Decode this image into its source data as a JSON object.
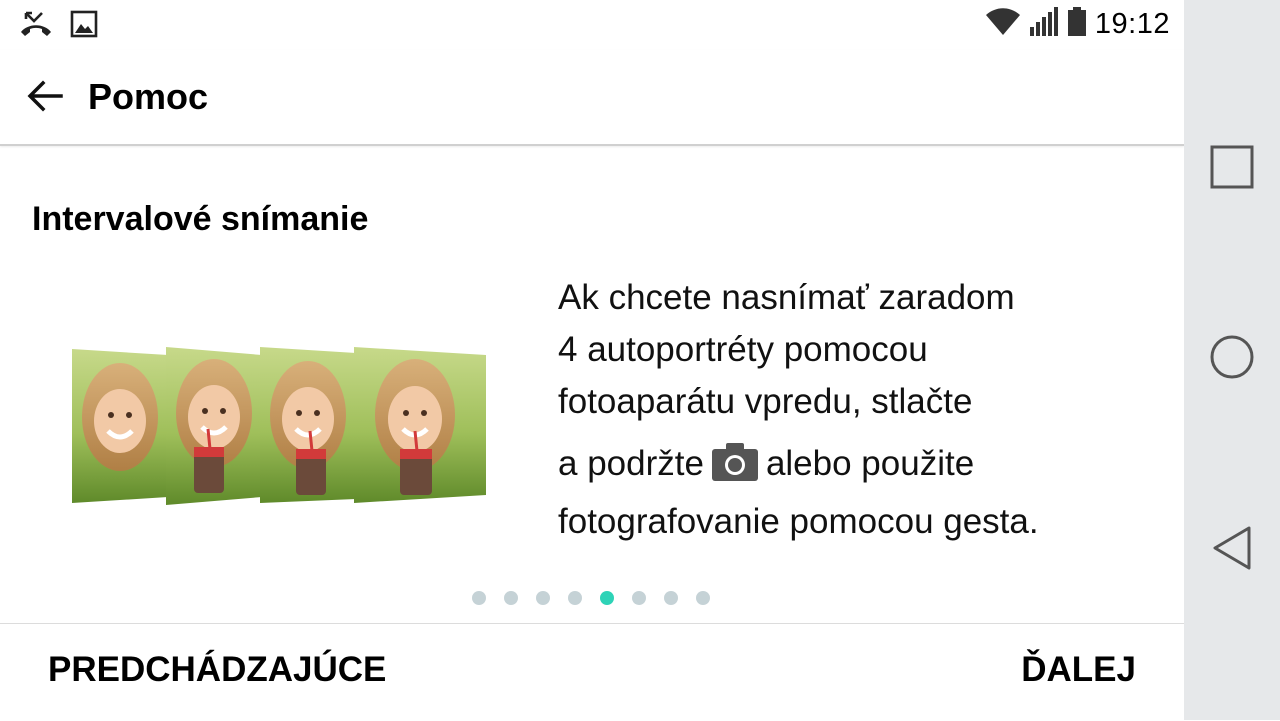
{
  "status_bar": {
    "time": "19:12",
    "left_icons": [
      "missed-call-icon",
      "image-icon"
    ],
    "right_icons": [
      "wifi-icon",
      "signal-icon",
      "battery-icon"
    ]
  },
  "app_bar": {
    "back_icon": "arrow-left-icon",
    "title": "Pomoc"
  },
  "content": {
    "section_title": "Intervalové snímanie",
    "description_lines": [
      "Ak chcete nasnímať zaradom",
      "4 autoportréty pomocou",
      "fotoaparátu vpredu, stlačte",
      "a podržte",
      "alebo použite",
      "fotografovanie pomocou gesta."
    ],
    "inline_icon": "camera-icon",
    "page_indicator": {
      "total": 8,
      "current": 5
    }
  },
  "footer": {
    "prev_label": "PREDCHÁDZAJÚCE",
    "next_label": "ĎALEJ"
  },
  "nav_bar": {
    "icons": [
      "recent-apps-icon",
      "home-icon",
      "back-icon"
    ]
  },
  "colors": {
    "accent_dot": "#2ed3b7",
    "inactive_dot": "#c5d2d6",
    "nav_bar_bg": "#e6e8ea"
  }
}
